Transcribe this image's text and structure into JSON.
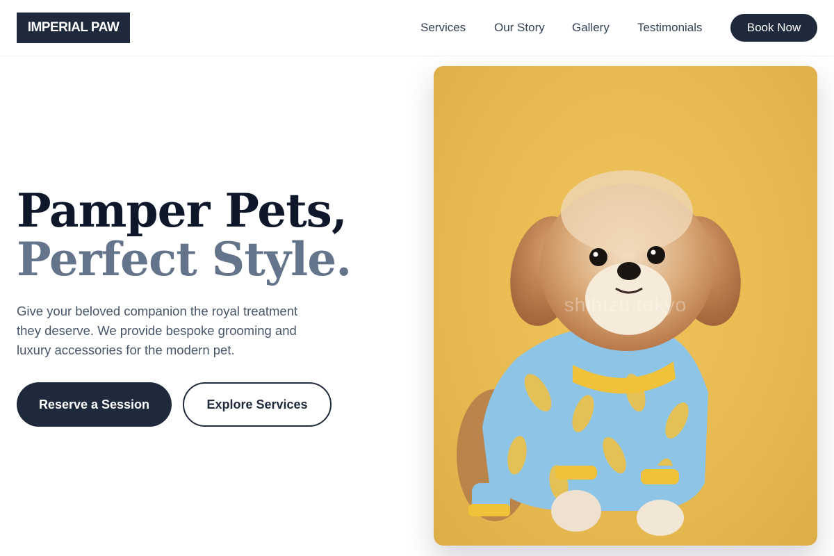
{
  "brand": {
    "name": "IMPERIAL PAW"
  },
  "nav": {
    "links": [
      "Services",
      "Our Story",
      "Gallery",
      "Testimonials"
    ],
    "cta": "Book Now"
  },
  "hero": {
    "headline_line1": "Pamper Pets,",
    "headline_line2": "Perfect Style.",
    "lead": "Give your beloved companion the royal treatment they deserve. We provide bespoke grooming and luxury accessories for the modern pet.",
    "primary_cta": "Reserve a Session",
    "secondary_cta": "Explore Services",
    "image_watermark": "shihtzu.tokyo"
  },
  "colors": {
    "navy": "#1e293b",
    "slate": "#64748b",
    "photo_background": "#e8bb52",
    "sweater": "#8ec5e6"
  },
  "icons": {
    "hero_image": "dog-photo"
  }
}
